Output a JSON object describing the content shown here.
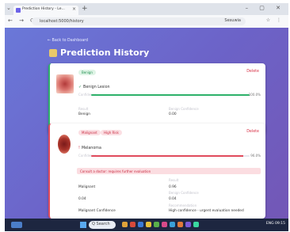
{
  "browser": {
    "tab_title": "Prediction History - Le...",
    "tab_close": "×",
    "new_tab": "+",
    "url": "localhost:5000/history",
    "toolbar_right": "Sesuwia",
    "window_controls": "– ▢ ✕"
  },
  "page": {
    "back_link": "← Back to Dashboard",
    "title": "Prediction History"
  },
  "cards": [
    {
      "badges": [
        "Benign"
      ],
      "delete": "Delete",
      "prediction": "Benign Lesion",
      "confidence_label": "Confidence",
      "confidence": 100.0,
      "confidence_text": "100.0%",
      "details": [
        {
          "label": "Result",
          "value": "Benign"
        },
        {
          "label": "Benign Confidence",
          "value": "0.00"
        }
      ]
    },
    {
      "badges": [
        "Malignant",
        "High Risk"
      ],
      "delete": "Delete",
      "prediction": "Melanoma",
      "confidence_label": "Confidence",
      "confidence": 96.0,
      "confidence_text": "96.0%",
      "warning": "Consult a doctor: requires further evaluation",
      "details": [
        {
          "label": "Result",
          "value": "Malignant"
        },
        {
          "label": "Benign Confidence",
          "value": "0.04"
        },
        {
          "label": "Malignant Confidence",
          "value": "0.96"
        },
        {
          "label": "Recommendation",
          "value": "High confidence - urgent evaluation needed"
        }
      ]
    }
  ],
  "taskbar": {
    "search_placeholder": "Q Search",
    "tray": "ENG  09:15"
  },
  "colors": {
    "benign_bar": "#2eb16a",
    "malignant_bar": "#e04a5c",
    "page_bg_start": "#6a78d8",
    "page_bg_end": "#7357b6"
  }
}
